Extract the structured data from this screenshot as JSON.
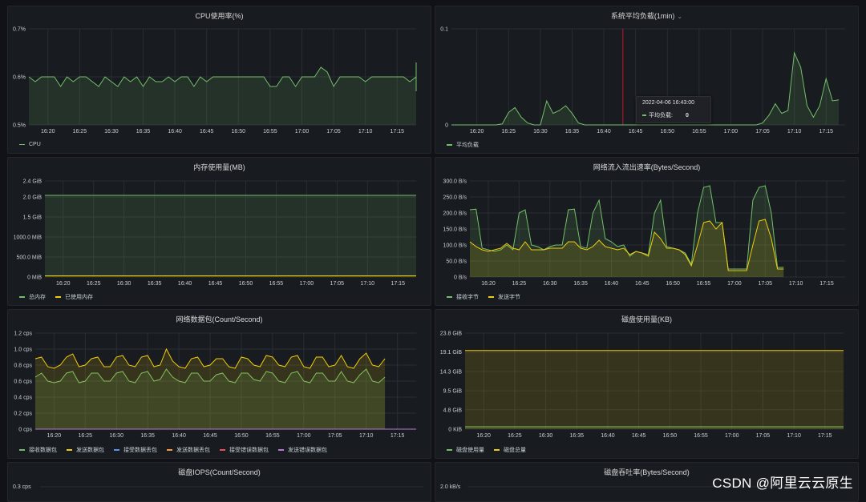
{
  "panels": [
    {
      "id": "cpu",
      "title": "CPU使用率(%)",
      "dropdown": false,
      "legend": [
        {
          "name": "CPU",
          "color": "#73bf69"
        }
      ],
      "chart_data": {
        "type": "area",
        "ylim": [
          0.5,
          0.7
        ],
        "yticks": [
          0.5,
          0.6,
          0.7
        ],
        "ytick_labels": [
          "0.5%",
          "0.6%",
          "0.7%"
        ],
        "xlim": [
          "16:17",
          "17:18"
        ],
        "xticks": [
          "16:20",
          "16:25",
          "16:30",
          "16:35",
          "16:40",
          "16:45",
          "16:50",
          "16:55",
          "17:00",
          "17:05",
          "17:10",
          "17:15"
        ],
        "series": [
          {
            "name": "CPU",
            "color": "#73bf69",
            "x_start": "16:17",
            "step_min": 1,
            "values": [
              0.6,
              0.59,
              0.6,
              0.6,
              0.6,
              0.58,
              0.6,
              0.59,
              0.6,
              0.6,
              0.59,
              0.58,
              0.6,
              0.59,
              0.58,
              0.6,
              0.59,
              0.6,
              0.58,
              0.6,
              0.59,
              0.59,
              0.6,
              0.59,
              0.6,
              0.6,
              0.58,
              0.6,
              0.59,
              0.6,
              0.6,
              0.6,
              0.6,
              0.6,
              0.6,
              0.6,
              0.6,
              0.6,
              0.58,
              0.58,
              0.6,
              0.6,
              0.58,
              0.6,
              0.6,
              0.6,
              0.62,
              0.61,
              0.58,
              0.6,
              0.6,
              0.6,
              0.6,
              0.59,
              0.6,
              0.6,
              0.6,
              0.6,
              0.6,
              0.6,
              0.59,
              0.6,
              0.63,
              0.58,
              0.6,
              0.6,
              0.57
            ]
          }
        ]
      }
    },
    {
      "id": "load",
      "title": "系统平均负载(1min)",
      "dropdown": true,
      "legend": [
        {
          "name": "平均负载",
          "color": "#73bf69"
        }
      ],
      "tooltip": {
        "time": "2022-04-06 16:43:00",
        "label": "平均负载:",
        "value": "0"
      },
      "chart_data": {
        "type": "area",
        "ylim": [
          0,
          0.1
        ],
        "yticks": [
          0,
          0.1
        ],
        "ytick_labels": [
          "0",
          "0.1"
        ],
        "xlim": [
          "16:16",
          "17:18"
        ],
        "xticks": [
          "16:20",
          "16:25",
          "16:30",
          "16:35",
          "16:40",
          "16:45",
          "16:50",
          "16:55",
          "17:00",
          "17:05",
          "17:10",
          "17:15"
        ],
        "cursor_x": "16:43",
        "series": [
          {
            "name": "平均负载",
            "color": "#73bf69",
            "x_start": "16:16",
            "step_min": 1,
            "values": [
              0,
              0,
              0,
              0,
              0,
              0,
              0,
              0,
              0.001,
              0.013,
              0.018,
              0.008,
              0.002,
              0,
              0,
              0.025,
              0.012,
              0.015,
              0.02,
              0.012,
              0.002,
              0,
              0,
              0,
              0,
              0,
              0,
              0,
              0,
              0,
              0,
              0,
              0,
              0,
              0,
              0,
              0,
              0,
              0,
              0,
              0,
              0,
              0,
              0,
              0,
              0,
              0,
              0,
              0,
              0.002,
              0.01,
              0.022,
              0.012,
              0.015,
              0.075,
              0.06,
              0.02,
              0.008,
              0.02,
              0.048,
              0.025,
              0.026
            ]
          }
        ]
      }
    },
    {
      "id": "mem",
      "title": "内存使用量(MB)",
      "dropdown": false,
      "legend": [
        {
          "name": "总内存",
          "color": "#73bf69"
        },
        {
          "name": "已使用内存",
          "color": "#f2cc0c"
        }
      ],
      "chart_data": {
        "type": "area",
        "ylim": [
          0,
          2.4
        ],
        "yticks": [
          0,
          0.5,
          1.0,
          1.5,
          2.0,
          2.4
        ],
        "ytick_labels": [
          "0 MiB",
          "500.0 MiB",
          "1000.0 MiB",
          "1.5 GiB",
          "2.0 GiB",
          "2.4 GiB"
        ],
        "xlim": [
          "16:17",
          "17:18"
        ],
        "xticks": [
          "16:20",
          "16:25",
          "16:30",
          "16:35",
          "16:40",
          "16:45",
          "16:50",
          "16:55",
          "17:00",
          "17:05",
          "17:10",
          "17:15"
        ],
        "series": [
          {
            "name": "总内存",
            "color": "#73bf69",
            "unit": "GiB",
            "constant": 2.04
          },
          {
            "name": "已使用内存",
            "color": "#f2cc0c",
            "unit": "GiB",
            "constant": 0.03
          }
        ]
      }
    },
    {
      "id": "net",
      "title": "网络流入流出速率(Bytes/Second)",
      "dropdown": false,
      "legend": [
        {
          "name": "接收字节",
          "color": "#73bf69"
        },
        {
          "name": "发送字节",
          "color": "#f2cc0c"
        }
      ],
      "chart_data": {
        "type": "area",
        "ylim": [
          0,
          300
        ],
        "yticks": [
          0,
          50,
          100,
          150,
          200,
          250,
          300
        ],
        "ytick_labels": [
          "0 B/s",
          "50.0 B/s",
          "100.0 B/s",
          "150.0 B/s",
          "200.0 B/s",
          "250.0 B/s",
          "300.0 B/s"
        ],
        "xlim": [
          "16:17",
          "17:18"
        ],
        "xticks": [
          "16:20",
          "16:25",
          "16:30",
          "16:35",
          "16:40",
          "16:45",
          "16:50",
          "16:55",
          "17:00",
          "17:05",
          "17:10",
          "17:15"
        ],
        "series": [
          {
            "name": "接收字节",
            "color": "#73bf69",
            "x_start": "16:17",
            "step_min": 1,
            "values": [
              210,
              212,
              90,
              85,
              80,
              85,
              100,
              85,
              200,
              210,
              100,
              95,
              85,
              95,
              100,
              100,
              210,
              212,
              95,
              90,
              200,
              240,
              120,
              110,
              95,
              100,
              65,
              80,
              75,
              70,
              200,
              240,
              95,
              90,
              85,
              75,
              40,
              200,
              280,
              285,
              170,
              170,
              25,
              25,
              25,
              25,
              240,
              280,
              285,
              200,
              30,
              30
            ]
          },
          {
            "name": "发送字节",
            "color": "#f2cc0c",
            "x_start": "16:17",
            "step_min": 1,
            "values": [
              110,
              95,
              85,
              80,
              85,
              90,
              105,
              90,
              85,
              110,
              85,
              85,
              85,
              90,
              90,
              90,
              110,
              110,
              90,
              85,
              95,
              115,
              95,
              90,
              85,
              90,
              70,
              80,
              75,
              65,
              140,
              120,
              90,
              90,
              85,
              70,
              35,
              100,
              170,
              175,
              150,
              170,
              20,
              20,
              20,
              20,
              100,
              175,
              180,
              120,
              25,
              25
            ]
          }
        ]
      }
    },
    {
      "id": "pkts",
      "title": "网络数据包(Count/Second)",
      "dropdown": false,
      "legend": [
        {
          "name": "接收数据包",
          "color": "#73bf69"
        },
        {
          "name": "发送数据包",
          "color": "#f2cc0c"
        },
        {
          "name": "接受数据丢包",
          "color": "#5794f2"
        },
        {
          "name": "发送数据丢包",
          "color": "#ff9830"
        },
        {
          "name": "接受错误数据包",
          "color": "#f2495c"
        },
        {
          "name": "发送错误数据包",
          "color": "#b877d9"
        }
      ],
      "chart_data": {
        "type": "area",
        "ylim": [
          0,
          1.2
        ],
        "yticks": [
          0,
          0.2,
          0.4,
          0.6,
          0.8,
          1.0,
          1.2
        ],
        "ytick_labels": [
          "0 cps",
          "0.2 cps",
          "0.4 cps",
          "0.6 cps",
          "0.8 cps",
          "1.0 cps",
          "1.2 cps"
        ],
        "xlim": [
          "16:17",
          "17:18"
        ],
        "xticks": [
          "16:20",
          "16:25",
          "16:30",
          "16:35",
          "16:40",
          "16:45",
          "16:50",
          "16:55",
          "17:00",
          "17:05",
          "17:10",
          "17:15"
        ],
        "series": [
          {
            "name": "接收数据包",
            "color": "#73bf69",
            "x_start": "16:17",
            "step_min": 1,
            "values": [
              0.65,
              0.7,
              0.6,
              0.58,
              0.6,
              0.7,
              0.72,
              0.58,
              0.6,
              0.7,
              0.7,
              0.6,
              0.6,
              0.7,
              0.72,
              0.6,
              0.58,
              0.7,
              0.72,
              0.6,
              0.62,
              0.75,
              0.65,
              0.6,
              0.58,
              0.7,
              0.7,
              0.6,
              0.6,
              0.68,
              0.7,
              0.6,
              0.58,
              0.7,
              0.7,
              0.62,
              0.6,
              0.72,
              0.7,
              0.6,
              0.58,
              0.7,
              0.72,
              0.6,
              0.58,
              0.7,
              0.7,
              0.6,
              0.6,
              0.72,
              0.6,
              0.58,
              0.68,
              0.75,
              0.6,
              0.58,
              0.65
            ]
          },
          {
            "name": "发送数据包",
            "color": "#f2cc0c",
            "x_start": "16:17",
            "step_min": 1,
            "values": [
              0.88,
              0.9,
              0.78,
              0.76,
              0.8,
              0.9,
              0.94,
              0.78,
              0.8,
              0.88,
              0.9,
              0.78,
              0.78,
              0.9,
              0.92,
              0.8,
              0.78,
              0.9,
              0.92,
              0.78,
              0.8,
              1.0,
              0.85,
              0.78,
              0.76,
              0.88,
              0.9,
              0.78,
              0.8,
              0.88,
              0.88,
              0.78,
              0.76,
              0.9,
              0.88,
              0.8,
              0.78,
              0.92,
              0.9,
              0.8,
              0.78,
              0.9,
              0.92,
              0.78,
              0.76,
              0.9,
              0.9,
              0.78,
              0.8,
              0.92,
              0.78,
              0.76,
              0.88,
              0.95,
              0.8,
              0.78,
              0.88
            ]
          },
          {
            "name": "接受数据丢包",
            "color": "#5794f2",
            "constant": 0
          },
          {
            "name": "发送数据丢包",
            "color": "#ff9830",
            "constant": 0
          },
          {
            "name": "接受错误数据包",
            "color": "#f2495c",
            "constant": 0
          },
          {
            "name": "发送错误数据包",
            "color": "#b877d9",
            "constant": 0
          }
        ]
      }
    },
    {
      "id": "disk",
      "title": "磁盘使用量(KB)",
      "dropdown": false,
      "legend": [
        {
          "name": "磁盘使用量",
          "color": "#73bf69"
        },
        {
          "name": "磁盘总量",
          "color": "#f2cc0c"
        }
      ],
      "chart_data": {
        "type": "area",
        "ylim": [
          0,
          23.8
        ],
        "yticks": [
          0,
          4.8,
          9.5,
          14.3,
          19.1,
          23.8
        ],
        "ytick_labels": [
          "0 KiB",
          "4.8 GiB",
          "9.5 GiB",
          "14.3 GiB",
          "19.1 GiB",
          "23.8 GiB"
        ],
        "xlim": [
          "16:17",
          "17:18"
        ],
        "xticks": [
          "16:20",
          "16:25",
          "16:30",
          "16:35",
          "16:40",
          "16:45",
          "16:50",
          "16:55",
          "17:00",
          "17:05",
          "17:10",
          "17:15"
        ],
        "series": [
          {
            "name": "磁盘使用量",
            "color": "#73bf69",
            "unit": "GiB",
            "constant": 0.6
          },
          {
            "name": "磁盘总量",
            "color": "#f2cc0c",
            "unit": "GiB",
            "constant": 19.5
          }
        ]
      }
    },
    {
      "id": "iops",
      "title": "磁盘IOPS(Count/Second)",
      "dropdown": false,
      "legend": [],
      "chart_data": {
        "type": "area",
        "yticks_visible": [
          "0.3 cps"
        ]
      }
    },
    {
      "id": "throughput",
      "title": "磁盘吞吐率(Bytes/Second)",
      "dropdown": false,
      "legend": [],
      "chart_data": {
        "type": "area",
        "yticks_visible": [
          "2.0 kB/s"
        ]
      }
    }
  ],
  "watermark": "CSDN @阿里云云原生"
}
